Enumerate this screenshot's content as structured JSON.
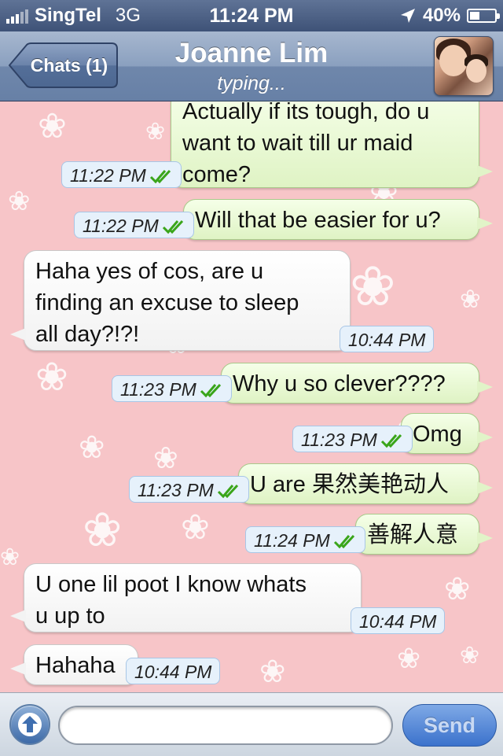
{
  "status_bar": {
    "carrier": "SingTel",
    "network": "3G",
    "time": "11:24 PM",
    "battery_percent": "40%",
    "battery_level": 0.4
  },
  "nav": {
    "back_label": "Chats (1)",
    "contact_name": "Joanne Lim",
    "status": "typing..."
  },
  "messages": [
    {
      "dir": "out",
      "lines": [
        "Actually if its tough, do u",
        "want to wait till ur maid",
        "come?"
      ],
      "time": "11:22 PM",
      "read": true
    },
    {
      "dir": "out",
      "lines": [
        "Will that be easier for u?"
      ],
      "time": "11:22 PM",
      "read": true
    },
    {
      "dir": "in",
      "lines": [
        "Haha yes of cos,  are u",
        "finding an excuse to sleep",
        "all day?!?!"
      ],
      "time": "10:44 PM"
    },
    {
      "dir": "out",
      "lines": [
        "Why u so clever????"
      ],
      "time": "11:23 PM",
      "read": true
    },
    {
      "dir": "out",
      "lines": [
        "Omg"
      ],
      "time": "11:23 PM",
      "read": true
    },
    {
      "dir": "out",
      "lines": [
        "U are 果然美艳动人"
      ],
      "time": "11:23 PM",
      "read": true
    },
    {
      "dir": "out",
      "lines": [
        "善解人意"
      ],
      "time": "11:24 PM",
      "read": true
    },
    {
      "dir": "in",
      "lines": [
        "U one lil poot I know whats",
        "u up to"
      ],
      "time": "10:44 PM"
    },
    {
      "dir": "in",
      "lines": [
        "Hahaha"
      ],
      "time": "10:44 PM"
    }
  ],
  "input": {
    "placeholder": "",
    "value": "",
    "send_label": "Send"
  },
  "icons": {
    "attach": "arrow-up-circle-icon",
    "read_receipt": "double-check-icon",
    "location": "location-arrow-icon",
    "background": "flower-icon"
  },
  "colors": {
    "outgoing_bubble": "#dff3c4",
    "incoming_bubble": "#ffffff",
    "chat_background": "#f7c5c8",
    "nav_bar": "#6f87ab",
    "read_tick": "#3aa51a"
  }
}
